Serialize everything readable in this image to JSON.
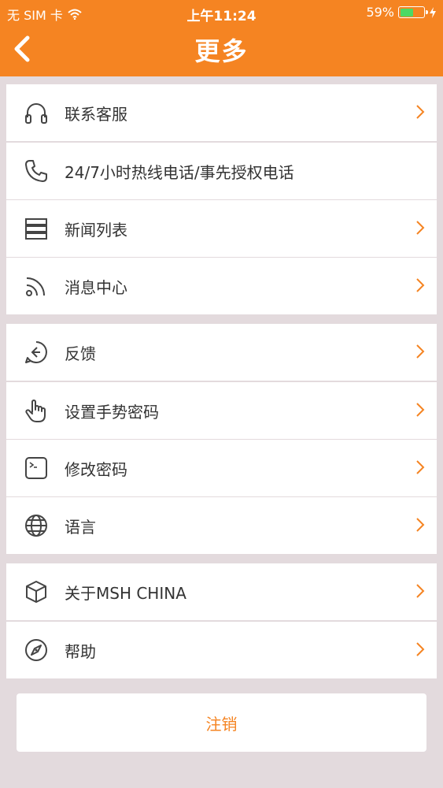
{
  "status_bar": {
    "carrier": "无 SIM 卡",
    "time": "上午11:24",
    "battery_percent_label": "59%",
    "battery_level": 0.59
  },
  "nav": {
    "title": "更多"
  },
  "groups": [
    {
      "items": [
        {
          "label": "联系客服",
          "icon": "headset-icon",
          "chevron": true
        },
        {
          "label": "24/7小时热线电话/事先授权电话",
          "icon": "phone-icon",
          "chevron": false
        },
        {
          "label": "新闻列表",
          "icon": "server-list-icon",
          "chevron": true
        },
        {
          "label": "消息中心",
          "icon": "rss-icon",
          "chevron": true
        }
      ]
    },
    {
      "items": [
        {
          "label": "反馈",
          "icon": "feedback-icon",
          "chevron": true
        },
        {
          "label": "设置手势密码",
          "icon": "hand-pointer-icon",
          "chevron": true
        },
        {
          "label": "修改密码",
          "icon": "terminal-icon",
          "chevron": true
        },
        {
          "label": "语言",
          "icon": "globe-icon",
          "chevron": true
        }
      ]
    },
    {
      "items": [
        {
          "label": "关于MSH CHINA",
          "icon": "cube-icon",
          "chevron": true
        },
        {
          "label": "帮助",
          "icon": "compass-icon",
          "chevron": true
        }
      ]
    }
  ],
  "logout_label": "注销",
  "colors": {
    "accent": "#f58422",
    "background": "#e3dadd",
    "text": "#333333"
  }
}
